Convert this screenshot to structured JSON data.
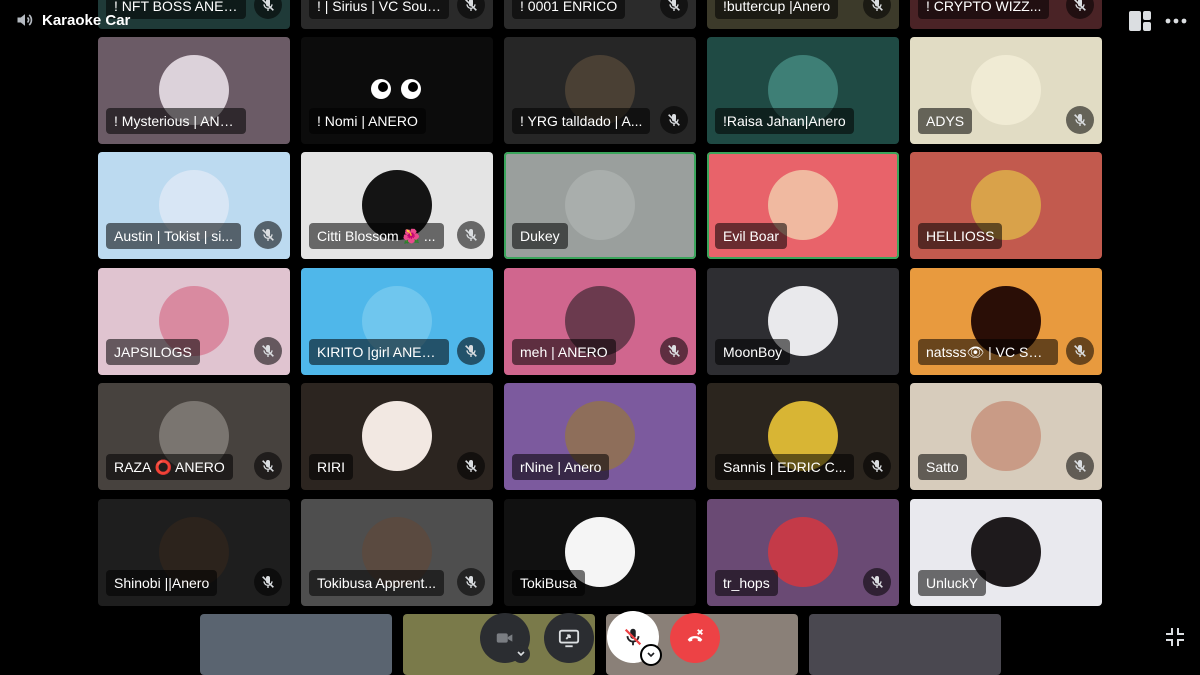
{
  "header": {
    "title": "Karaoke Car"
  },
  "top_row": [
    {
      "name": "! NFT BOSS ANERO",
      "color": "#1f3a38"
    },
    {
      "name": "! | Sirius | VC Soul...",
      "color": "#2a2a2a"
    },
    {
      "name": "! 0001 ENRICO",
      "color": "#2b2b2b"
    },
    {
      "name": "!buttercup |Anero",
      "color": "#3c3a2a"
    },
    {
      "name": "! CRYPTO WIZZ...",
      "color": "#4a2326"
    }
  ],
  "participants": [
    {
      "name": "! Mysterious | ANERO",
      "bg": "#6b5b66",
      "avatar": "#dcd2da",
      "muted": false,
      "speaking": false
    },
    {
      "name": "! Nomi | ANERO",
      "bg": "#0c0c0c",
      "avatar": "",
      "muted": false,
      "speaking": false
    },
    {
      "name": "! YRG talldado | A...",
      "bg": "#262626",
      "avatar": "#4a4034",
      "muted": true,
      "speaking": false
    },
    {
      "name": "!Raisa Jahan|Anero",
      "bg": "#1f4a44",
      "avatar": "#3e7f76",
      "muted": false,
      "speaking": false
    },
    {
      "name": "ADYS",
      "bg": "#e1dcc4",
      "avatar": "#f0ebd4",
      "muted": true,
      "speaking": false
    },
    {
      "name": "Austin | Tokist | si...",
      "bg": "#bcdaf0",
      "avatar": "#d8e6f5",
      "muted": true,
      "speaking": false
    },
    {
      "name": "Citti Blossom 🌺 ...",
      "bg": "#e4e4e4",
      "avatar": "#141414",
      "muted": true,
      "speaking": false
    },
    {
      "name": "Dukey",
      "bg": "#9a9f9d",
      "avatar": "#a9aeac",
      "muted": false,
      "speaking": true
    },
    {
      "name": "Evil Boar",
      "bg": "#e8636a",
      "avatar": "#f0b9a0",
      "muted": false,
      "speaking": true
    },
    {
      "name": "HELLIOSS",
      "bg": "#c25a4e",
      "avatar": "#d9a24a",
      "muted": false,
      "speaking": false
    },
    {
      "name": "JAPSILOGS",
      "bg": "#e0c4d0",
      "avatar": "#d98aa0",
      "muted": true,
      "speaking": false
    },
    {
      "name": "KIRITO |girl ANER...",
      "bg": "#4fb7ea",
      "avatar": "#6fc6ee",
      "muted": true,
      "speaking": false
    },
    {
      "name": "meh | ANERO",
      "bg": "#d0668e",
      "avatar": "#6b3a4e",
      "muted": true,
      "speaking": false
    },
    {
      "name": "MoonBoy",
      "bg": "#2e2e32",
      "avatar": "#e9e9ec",
      "muted": false,
      "speaking": false
    },
    {
      "name": "natsss👁 | VC Sou...",
      "bg": "#e89a3e",
      "avatar": "#2a0e06",
      "muted": true,
      "speaking": false
    },
    {
      "name": "RAZA ⭕ ANERO",
      "bg": "#47423e",
      "avatar": "#7a7570",
      "muted": true,
      "speaking": false
    },
    {
      "name": "RIRI",
      "bg": "#2c2520",
      "avatar": "#f2e8e2",
      "muted": true,
      "speaking": false
    },
    {
      "name": "rNine | Anero",
      "bg": "#7c5a9e",
      "avatar": "#8e6e5a",
      "muted": false,
      "speaking": false
    },
    {
      "name": "Sannis | EDRIC C...",
      "bg": "#2b251e",
      "avatar": "#d8b534",
      "muted": true,
      "speaking": false
    },
    {
      "name": "Satto",
      "bg": "#d7ccbc",
      "avatar": "#c99b86",
      "muted": true,
      "speaking": false
    },
    {
      "name": "Shinobi ||Anero",
      "bg": "#1e1e1e",
      "avatar": "#2c231c",
      "muted": true,
      "speaking": false
    },
    {
      "name": "Tokibusa Apprent...",
      "bg": "#4e4e4e",
      "avatar": "#5a4a40",
      "muted": true,
      "speaking": false
    },
    {
      "name": "TokiBusa",
      "bg": "#111111",
      "avatar": "#f5f5f5",
      "muted": false,
      "speaking": false
    },
    {
      "name": "tr_hops",
      "bg": "#6a4a74",
      "avatar": "#c43a48",
      "muted": true,
      "speaking": false
    },
    {
      "name": "UnluckY",
      "bg": "#e9e9ee",
      "avatar": "#1e1a1c",
      "muted": false,
      "speaking": false
    }
  ],
  "bottom_row": [
    {
      "color": "#5a6470"
    },
    {
      "color": "#7a7a4a"
    },
    {
      "color": "#8a8078"
    },
    {
      "color": "#4a4850"
    }
  ],
  "controls": {
    "camera": {
      "icon": "camera-off-icon"
    },
    "screen_share": {
      "icon": "screen-share-icon"
    },
    "mic": {
      "icon": "mic-muted-icon"
    },
    "disconnect": {
      "icon": "disconnect-icon",
      "color": "#ed4245"
    }
  },
  "colors": {
    "speaking_ring": "#3ba55c",
    "disconnect": "#ed4245"
  }
}
